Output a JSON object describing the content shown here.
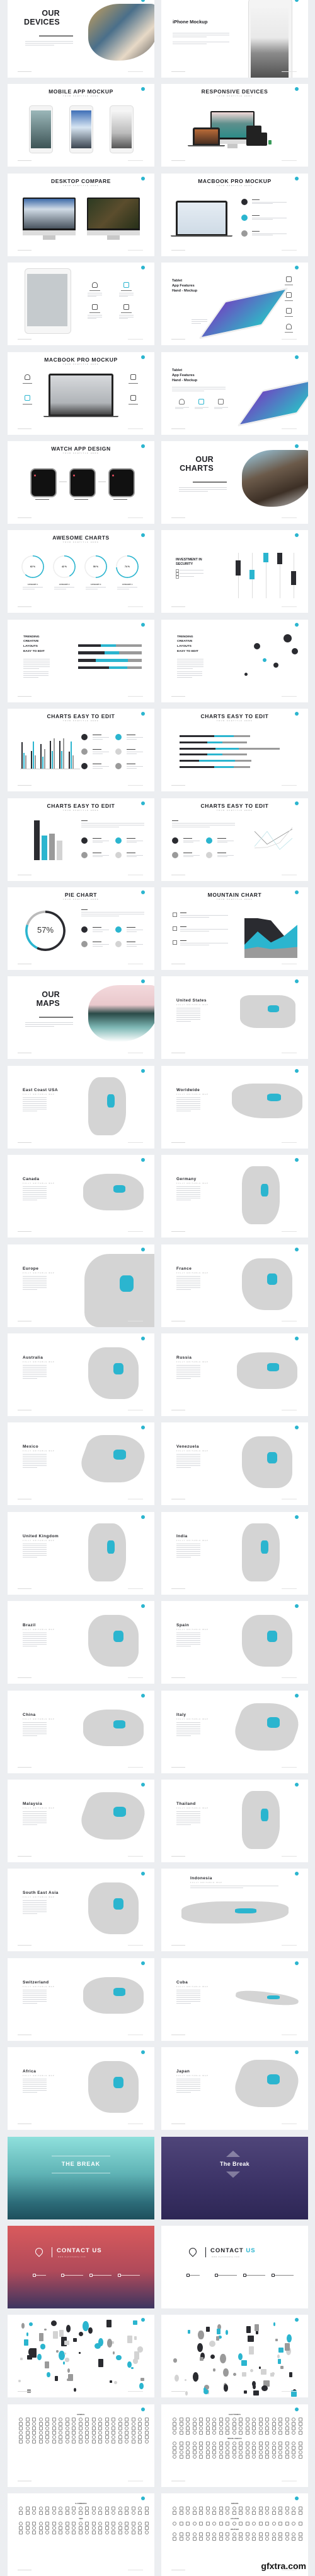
{
  "colors": {
    "accent": "#2bb5cf",
    "dark": "#2a2b30",
    "gray": "#9a9a9a",
    "light_gray": "#d3d3d3",
    "background": "#eceef1"
  },
  "watermark": "gfxtra.com",
  "slides": [
    {
      "kind": "section",
      "title_lines": [
        "OUR",
        "DEVICES"
      ],
      "image": "people-brush"
    },
    {
      "kind": "iphone",
      "title": "iPhone Mockup"
    },
    {
      "kind": "phones3",
      "title": "MOBILE APP MOCKUP",
      "subtitle": "YOUR SUBTITLE HERE"
    },
    {
      "kind": "responsive",
      "title": "RESPONSIVE DEVICES",
      "subtitle": "YOUR SUBTITLE HERE"
    },
    {
      "kind": "desktops2",
      "title": "DESKTOP COMPARE",
      "subtitle": "YOUR SUBTITLE HERE"
    },
    {
      "kind": "macbook-features",
      "title": "MACBOOK PRO MOCKUP",
      "subtitle": "YOUR SUBTITLE HERE"
    },
    {
      "kind": "tablet-icons",
      "icons": [
        "bell-icon",
        "sliders-icon",
        "wrench-icon",
        "picture-icon"
      ]
    },
    {
      "kind": "tablet-app",
      "title_lines": [
        "Tablet",
        "App Features",
        "Hand - Mockup"
      ],
      "side_icons": [
        "bluetooth-icon",
        "battery-icon",
        "video-icon",
        "bell-icon"
      ]
    },
    {
      "kind": "macbook-icons",
      "title": "MACBOOK PRO MOCKUP",
      "subtitle": "YOUR SUBTITLE HERE",
      "icons": [
        "bell-icon",
        "wrench-icon",
        "sliders-icon",
        "picture-icon"
      ]
    },
    {
      "kind": "tablet-app2",
      "title_lines": [
        "Tablet",
        "App Features",
        "Hand - Mockup"
      ],
      "icons": [
        "bell-icon",
        "wifi-icon",
        "wrench-icon"
      ]
    },
    {
      "kind": "watches",
      "title": "WATCH APP DESIGN",
      "subtitle": "YOUR SUBTITLE HERE"
    },
    {
      "kind": "section",
      "title_lines": [
        "OUR",
        "CHARTS"
      ],
      "image": "rock-brush"
    },
    {
      "kind": "donuts",
      "title": "AWESOME CHARTS",
      "subtitle": "YOUR SUBTITLE HERE",
      "donuts": [
        {
          "value": 62,
          "label": "62 %",
          "category": "CATEGORY 1"
        },
        {
          "value": 42,
          "label": "42 %",
          "category": "CATEGORY 2"
        },
        {
          "value": 50,
          "label": "50 %",
          "category": "CATEGORY 3"
        },
        {
          "value": 74,
          "label": "74 %",
          "category": "CATEGORY 4"
        }
      ]
    },
    {
      "kind": "investment",
      "title_lines": [
        "INVESTMENT IN",
        "SECURITY"
      ],
      "boxes": [
        {
          "low": 3,
          "high": 5,
          "color": "dark"
        },
        {
          "low": 2.5,
          "high": 3.8,
          "color": "accent"
        },
        {
          "low": 4.8,
          "high": 6,
          "color": "accent"
        },
        {
          "low": 4.5,
          "high": 6,
          "color": "dark"
        },
        {
          "low": 1.8,
          "high": 3.6,
          "color": "dark"
        }
      ]
    },
    {
      "kind": "trending-hbar",
      "title_lines": [
        "TRENDING",
        "CREATIVE",
        "LAYOUTS",
        "EASY TO EDIT"
      ],
      "bars": [
        [
          36,
          23,
          41
        ],
        [
          42,
          22,
          36
        ],
        [
          28,
          50,
          22
        ],
        [
          49,
          28,
          23
        ]
      ]
    },
    {
      "kind": "trending-bubble",
      "title_lines": [
        "TRENDING",
        "CREATIVE",
        "LAYOUTS",
        "EASY TO EDIT"
      ],
      "bubbles": [
        {
          "x": 3.5,
          "y": 7,
          "r": 5,
          "color": "dark"
        },
        {
          "x": 4.5,
          "y": 4.8,
          "r": 3,
          "color": "accent"
        },
        {
          "x": 6,
          "y": 4,
          "r": 4,
          "color": "dark"
        },
        {
          "x": 7.5,
          "y": 8.2,
          "r": 6.5,
          "color": "dark"
        },
        {
          "x": 8.5,
          "y": 6.2,
          "r": 5,
          "color": "dark"
        },
        {
          "x": 2,
          "y": 2.5,
          "r": 2.5,
          "color": "dark"
        }
      ]
    },
    {
      "kind": "vbars",
      "title": "CHARTS EASY TO EDIT",
      "subtitle": "YOUR SUBTITLE HERE",
      "groups": [
        [
          4.2,
          2.5,
          2.1
        ],
        [
          2.8,
          4.3,
          2.1
        ],
        [
          3.9,
          1.9,
          3.1
        ],
        [
          4.4,
          2.8,
          4.8
        ],
        [
          4.4,
          2.8,
          4.8
        ],
        [
          2.7,
          4.3,
          2.1
        ]
      ],
      "categories": [
        "CATEGORY 1",
        "CATEGORY 2",
        "CATEGORY 3",
        "CATEGORY 4",
        "CATEGORY 5",
        "CATEGORY 6"
      ]
    },
    {
      "kind": "hbar6",
      "title": "CHARTS EASY TO EDIT",
      "subtitle": "YOUR SUBTITLE HERE",
      "bars": [
        [
          2.1,
          1.2,
          1.0
        ],
        [
          1.7,
          0.9,
          1.5
        ],
        [
          2.2,
          1.4,
          2.5
        ],
        [
          1.7,
          0.9,
          1.5
        ],
        [
          1.2,
          2.2,
          1.0
        ],
        [
          2.1,
          1.2,
          1.0
        ]
      ]
    },
    {
      "kind": "single-bars",
      "title": "CHARTS EASY TO EDIT",
      "subtitle": "YOUR SUBTITLE HERE",
      "bars": [
        {
          "value": 9,
          "color": "dark"
        },
        {
          "value": 5.5,
          "color": "accent"
        },
        {
          "value": 6,
          "color": "gray"
        },
        {
          "value": 4.3,
          "color": "light_gray"
        }
      ],
      "categories": [
        "CATEGORY 1",
        "CATEGORY 2",
        "CATEGORY 3",
        "CATEGORY 4"
      ]
    },
    {
      "kind": "line",
      "title": "CHARTS EASY TO EDIT",
      "subtitle": "YOUR SUBTITLE HERE",
      "categories": [
        "CATEGORY 1",
        "CATEGORY 2",
        "CATEGORY 3",
        "CATEGORY 4"
      ],
      "series": [
        [
          4.3,
          2.6,
          3.6,
          4.6
        ],
        [
          2.3,
          4.3,
          1.9,
          3.4
        ],
        [
          2.1,
          2.2,
          2.8,
          4.8
        ]
      ]
    },
    {
      "kind": "pie",
      "title": "PIE CHART",
      "subtitle": "YOUR SUBTITLE HERE",
      "value": 57,
      "label": "57%",
      "categories": [
        "CATEGORY 1",
        "CATEGORY 2",
        "CATEGORY 3",
        "CATEGORY 4"
      ]
    },
    {
      "kind": "mountain",
      "title": "MOUNTAIN CHART",
      "subtitle": "YOUR SUBTITLE HERE",
      "series": [
        [
          9,
          9,
          8.5,
          5,
          4
        ],
        [
          3,
          6,
          3.5,
          5,
          7.5
        ],
        [
          2,
          2.5,
          2,
          2.2,
          2.5
        ]
      ]
    },
    {
      "kind": "section",
      "title_lines": [
        "OUR",
        "MAPS"
      ],
      "image": "lake-brush"
    },
    {
      "kind": "map",
      "title": "United States",
      "subtitle": "FULLY EDITABLE MAP",
      "shape": "usa"
    },
    {
      "kind": "map",
      "title": "East Coast USA",
      "subtitle": "FULLY EDITABLE MAP",
      "shape": "tall"
    },
    {
      "kind": "map",
      "title": "Worldwide",
      "subtitle": "FULLY EDITABLE MAP",
      "shape": "world"
    },
    {
      "kind": "map",
      "title": "Canada",
      "subtitle": "FULLY EDITABLE MAP",
      "shape": "wide"
    },
    {
      "kind": "map",
      "title": "Germany",
      "subtitle": "FULLY EDITABLE MAP",
      "shape": "tall"
    },
    {
      "kind": "map",
      "title": "Europe",
      "subtitle": "FULLY EDITABLE MAP",
      "shape": "europe"
    },
    {
      "kind": "map",
      "title": "France",
      "subtitle": "FULLY EDITABLE MAP",
      "shape": "square"
    },
    {
      "kind": "map",
      "title": "Australia",
      "subtitle": "FULLY EDITABLE MAP",
      "shape": "square"
    },
    {
      "kind": "map",
      "title": "Russia",
      "subtitle": "FULLY EDITABLE MAP",
      "shape": "wide"
    },
    {
      "kind": "map",
      "title": "Mexico",
      "subtitle": "FULLY EDITABLE MAP",
      "shape": "diag"
    },
    {
      "kind": "map",
      "title": "Venezuela",
      "subtitle": "FULLY EDITABLE MAP",
      "shape": "square"
    },
    {
      "kind": "map",
      "title": "United Kingdom",
      "subtitle": "FULLY EDITABLE MAP",
      "shape": "tall"
    },
    {
      "kind": "map",
      "title": "India",
      "subtitle": "FULLY EDITABLE MAP",
      "shape": "tall"
    },
    {
      "kind": "map",
      "title": "Brazil",
      "subtitle": "FULLY EDITABLE MAP",
      "shape": "square"
    },
    {
      "kind": "map",
      "title": "Spain",
      "subtitle": "FULLY EDITABLE MAP",
      "shape": "square"
    },
    {
      "kind": "map",
      "title": "China",
      "subtitle": "FULLY EDITABLE MAP",
      "shape": "wide"
    },
    {
      "kind": "map",
      "title": "Italy",
      "subtitle": "FULLY EDITABLE MAP",
      "shape": "diag"
    },
    {
      "kind": "map",
      "title": "Malaysia",
      "subtitle": "FULLY EDITABLE MAP",
      "shape": "diag"
    },
    {
      "kind": "map",
      "title": "Thailand",
      "subtitle": "FULLY EDITABLE MAP",
      "shape": "tall"
    },
    {
      "kind": "map",
      "title": "South East Asia",
      "subtitle": "FULLY EDITABLE MAP",
      "shape": "square"
    },
    {
      "kind": "map-wide",
      "title": "Indonesia",
      "subtitle": "FULLY EDITABLE MAP",
      "shape": "archipelago"
    },
    {
      "kind": "map",
      "title": "Switzerland",
      "subtitle": "FULLY EDITABLE MAP",
      "shape": "wide"
    },
    {
      "kind": "map",
      "title": "Cuba",
      "subtitle": "FULLY EDITABLE MAP",
      "shape": "thin"
    },
    {
      "kind": "map",
      "title": "Africa",
      "subtitle": "FULLY EDITABLE MAP",
      "shape": "square"
    },
    {
      "kind": "map",
      "title": "Japan",
      "subtitle": "FULLY EDITABLE MAP",
      "shape": "diag"
    },
    {
      "kind": "break",
      "title": "THE BREAK",
      "style": "teal"
    },
    {
      "kind": "break",
      "title": "The Break",
      "style": "purple"
    },
    {
      "kind": "contact",
      "title": "CONTACT",
      "title_accent": "US",
      "website": "www.mycompany.com",
      "style": "red"
    },
    {
      "kind": "contact",
      "title": "CONTACT",
      "title_accent": "US",
      "website": "www.mycompany.com",
      "style": "white"
    },
    {
      "kind": "infographic",
      "variant": 1
    },
    {
      "kind": "infographic",
      "variant": 2
    },
    {
      "kind": "icons",
      "sections": [
        {
          "label": "GENERAL",
          "rows": 6
        }
      ]
    },
    {
      "kind": "icons",
      "sections": [
        {
          "label": "ELECTRONICS",
          "rows": 4
        },
        {
          "label": "MISCELLANEOUS",
          "rows": 4
        }
      ]
    },
    {
      "kind": "icons",
      "sections": [
        {
          "label": "E-COMMERCE",
          "rows": 2
        },
        {
          "label": "WEB",
          "rows": 3
        }
      ]
    },
    {
      "kind": "icons",
      "sections": [
        {
          "label": "ARROWS",
          "rows": 2
        },
        {
          "label": "LOCATION",
          "rows": 1
        },
        {
          "label": "WEATHER",
          "rows": 2
        }
      ]
    }
  ]
}
